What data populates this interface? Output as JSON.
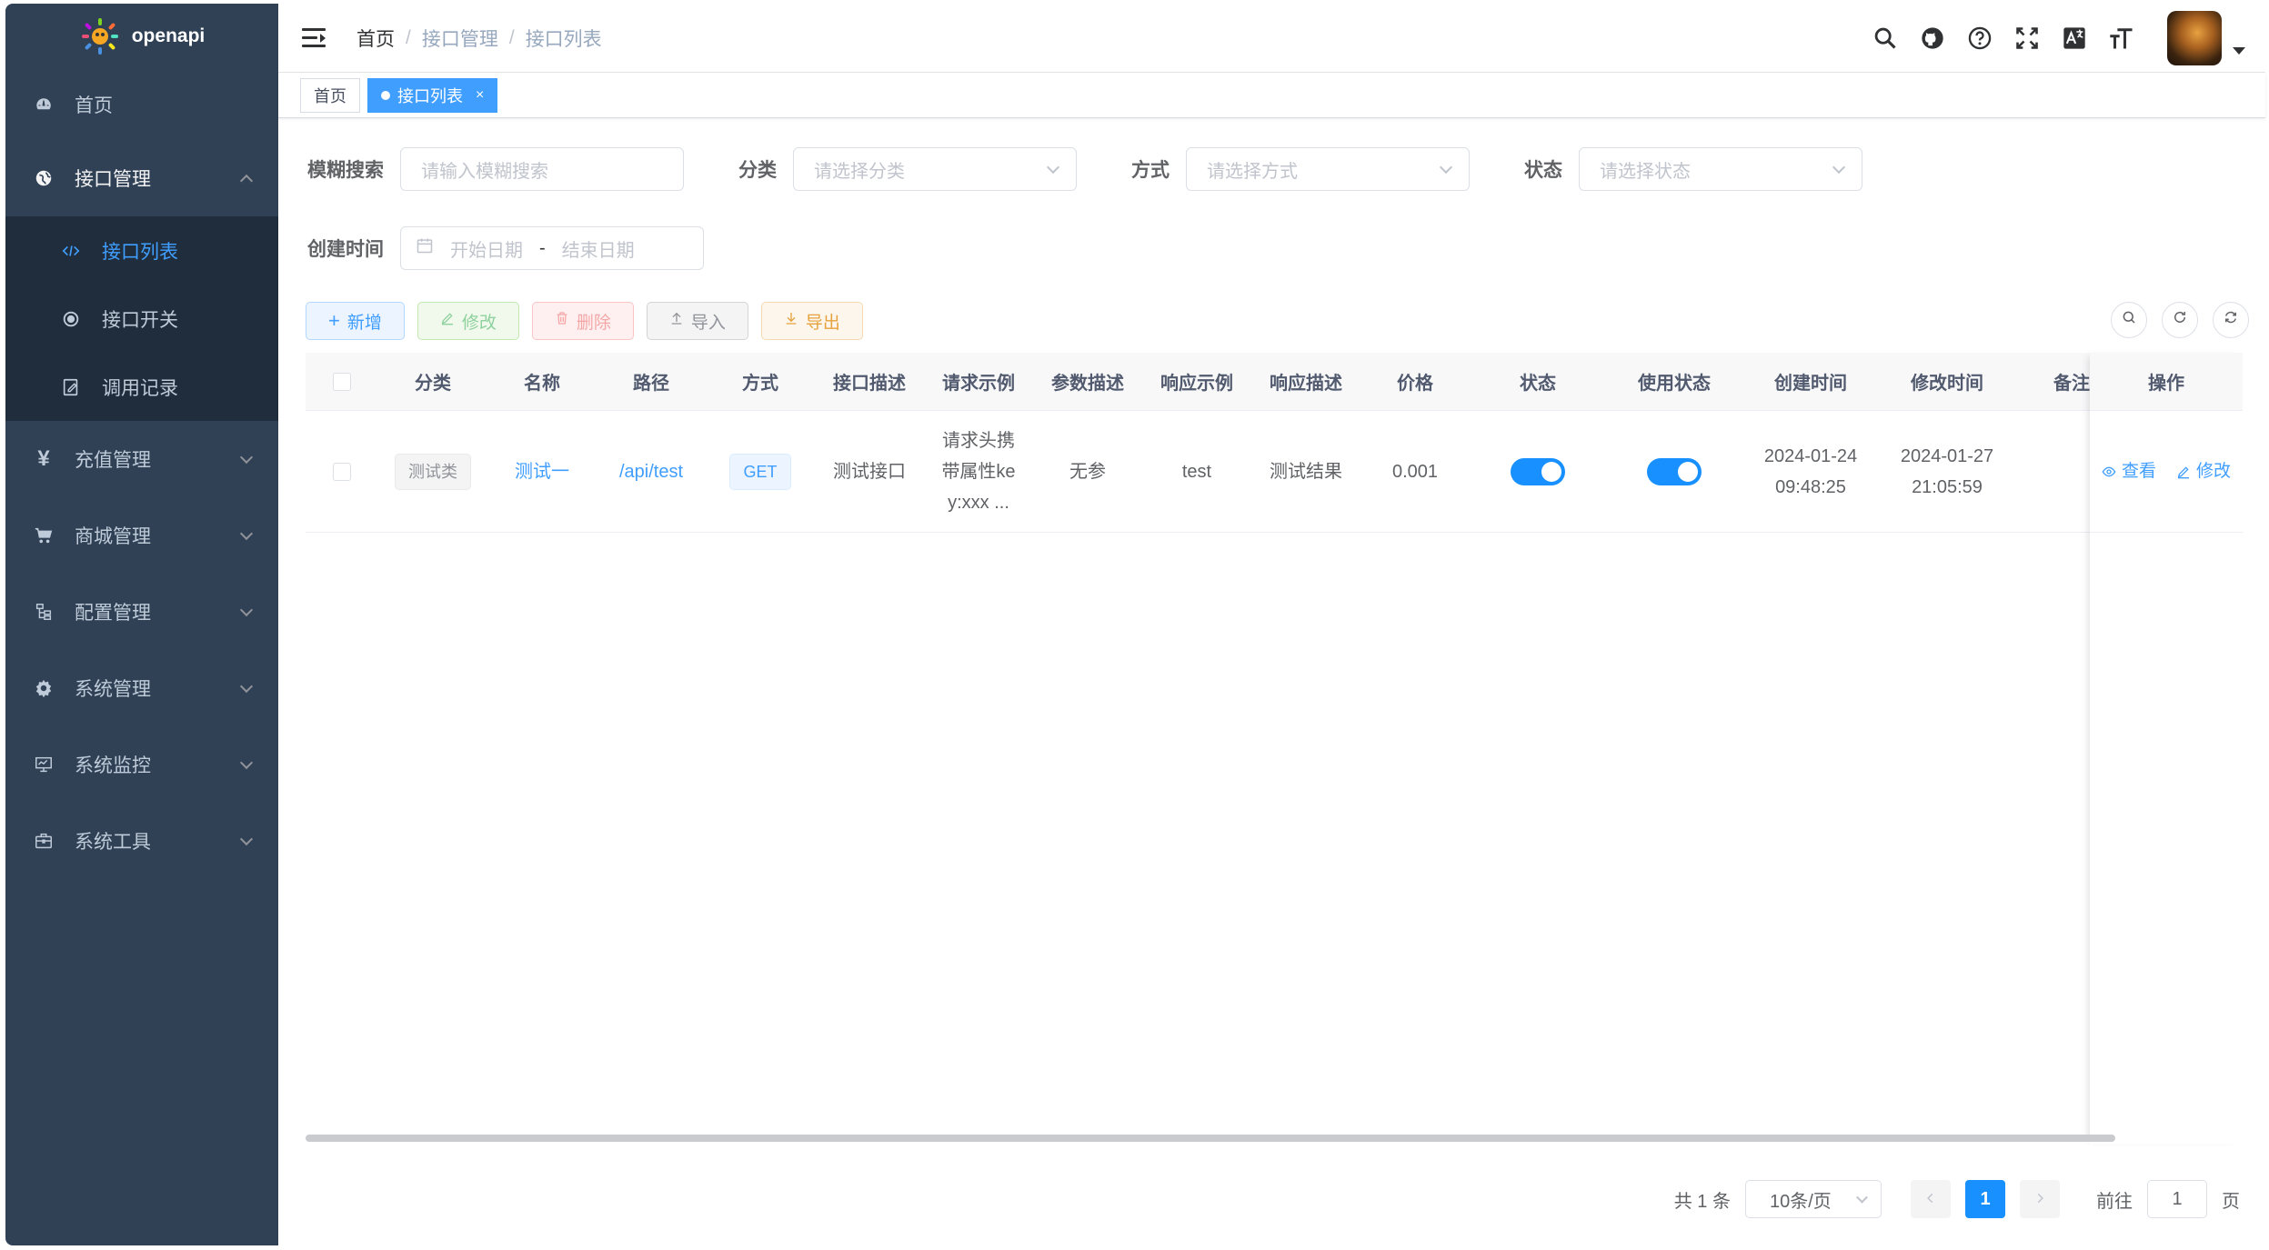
{
  "app": {
    "name": "openapi"
  },
  "sidebar": {
    "items": [
      {
        "label": "首页",
        "icon": "dashboard-icon"
      },
      {
        "label": "接口管理",
        "icon": "globe-icon",
        "open": true,
        "children": [
          {
            "label": "接口列表",
            "icon": "code-icon",
            "active": true
          },
          {
            "label": "接口开关",
            "icon": "radio-icon"
          },
          {
            "label": "调用记录",
            "icon": "edit-icon"
          }
        ]
      },
      {
        "label": "充值管理",
        "icon": "yen-icon"
      },
      {
        "label": "商城管理",
        "icon": "cart-icon"
      },
      {
        "label": "配置管理",
        "icon": "tree-icon"
      },
      {
        "label": "系统管理",
        "icon": "gear-icon"
      },
      {
        "label": "系统监控",
        "icon": "monitor-icon"
      },
      {
        "label": "系统工具",
        "icon": "toolbox-icon"
      }
    ]
  },
  "header": {
    "breadcrumb": [
      "首页",
      "接口管理",
      "接口列表"
    ],
    "separator": "/"
  },
  "tags": [
    {
      "label": "首页"
    },
    {
      "label": "接口列表",
      "active": true,
      "close": "×"
    }
  ],
  "search": {
    "fuzzy": {
      "label": "模糊搜索",
      "placeholder": "请输入模糊搜索"
    },
    "category": {
      "label": "分类",
      "placeholder": "请选择分类"
    },
    "method": {
      "label": "方式",
      "placeholder": "请选择方式"
    },
    "status": {
      "label": "状态",
      "placeholder": "请选择状态"
    },
    "created": {
      "label": "创建时间",
      "start": "开始日期",
      "sep": "-",
      "end": "结束日期"
    }
  },
  "toolbar": {
    "add": "新增",
    "edit": "修改",
    "delete": "删除",
    "import": "导入",
    "export": "导出"
  },
  "table": {
    "columns": [
      "分类",
      "名称",
      "路径",
      "方式",
      "接口描述",
      "请求示例",
      "参数描述",
      "响应示例",
      "响应描述",
      "价格",
      "状态",
      "使用状态",
      "创建时间",
      "修改时间",
      "备注",
      "操作"
    ],
    "rows": [
      {
        "category": "测试类",
        "name": "测试一",
        "path": "/api/test",
        "method": "GET",
        "desc": "测试接口",
        "req_line1": "请求头携",
        "req_line2": "带属性ke",
        "req_line3": "y:xxx ...",
        "param_desc": "无参",
        "resp_example": "test",
        "resp_desc": "测试结果",
        "price": "0.001",
        "status_on": true,
        "use_status_on": true,
        "created_date": "2024-01-24",
        "created_time": "09:48:25",
        "modified_date": "2024-01-27",
        "modified_time": "21:05:59",
        "remark": "",
        "op_view": "查看",
        "op_edit": "修改"
      }
    ]
  },
  "pagination": {
    "total_text": "共 1 条",
    "page_size": "10条/页",
    "current_page": "1",
    "goto_label": "前往",
    "goto_value": "1",
    "page_suffix": "页"
  },
  "colors": {
    "primary": "#409eff",
    "sidebar_bg": "#304156",
    "submenu_bg": "#1f2d3d",
    "switch_on": "#1890ff"
  }
}
